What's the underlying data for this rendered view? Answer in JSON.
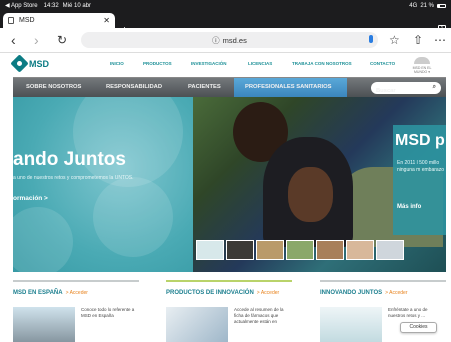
{
  "status_bar": {
    "carrier": "◀ App Store",
    "time": "14:32",
    "date": "Mié 10 abr",
    "signal": "4G",
    "battery": "21 %"
  },
  "tab": {
    "title": "MSD",
    "close": "✕",
    "new_tab": "+",
    "count": "1"
  },
  "toolbar": {
    "back": "‹",
    "forward": "›",
    "reload": "↻",
    "url": "msd.es",
    "lock": "ⓘ",
    "bookmark": "☆",
    "share": "⇧",
    "more": "⋯"
  },
  "site": {
    "logo_text": "MSD",
    "top_nav": [
      "INICIO",
      "PRODUCTOS",
      "INVESTIGACIÓN",
      "LICENCIAS",
      "TRABAJA CON NOSOTROS",
      "CONTACTO"
    ],
    "world_label": "MSD EN EL MUNDO ▾",
    "main_nav": [
      "SOBRE NOSOTROS",
      "RESPONSABILIDAD",
      "PACIENTES",
      "PROFESIONALES SANITARIOS"
    ],
    "search_placeholder": "Buscar",
    "hero": {
      "title": "ando Juntos",
      "subtitle": "a uno de nuestros retos y comprometemos la UNTOS.",
      "link": "ormación >",
      "right_title": "MSD p",
      "right_text": "En 2011 l 500 millo ninguna m embarazo",
      "right_link": "Más info"
    },
    "columns": [
      {
        "heading": "MSD EN ESPAÑA",
        "accent": "> Acceder",
        "text": "Conoce todo lo referente a MSD en España",
        "bar_color": "#c7cccd"
      },
      {
        "heading": "PRODUCTOS DE INNOVACIÓN",
        "accent": "> Acceder",
        "text": "Accede al resumen de la ficha de fármacos que actualmente están en",
        "bar_color": "#b9d36a"
      },
      {
        "heading": "INNOVANDO JUNTOS",
        "accent": "> Acceder",
        "text": "Enfréntate a uno de nuestros retos y ...",
        "bar_color": "#c7cccd"
      }
    ],
    "cookies": "Cookies"
  }
}
